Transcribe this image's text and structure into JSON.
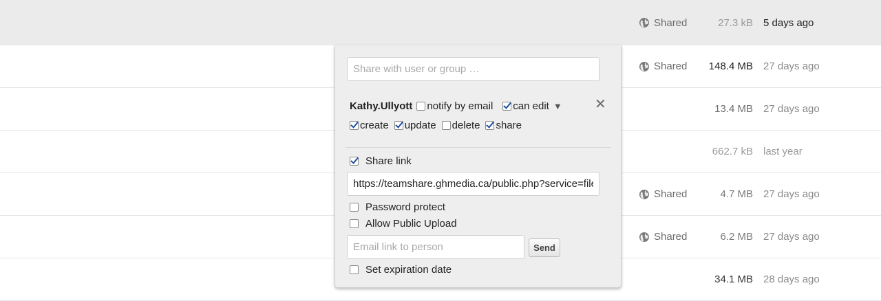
{
  "rows": [
    {
      "shared": "Shared",
      "size": "27.3 kB",
      "date": "5 days ago",
      "size_color": "#9a9a9a",
      "date_color": "#222222"
    },
    {
      "shared": "Shared",
      "size": "148.4 MB",
      "date": "27 days ago",
      "size_color": "#222222",
      "date_color": "#8a8a8a"
    },
    {
      "shared": "",
      "size": "13.4 MB",
      "date": "27 days ago",
      "size_color": "#6e6e6e",
      "date_color": "#8a8a8a"
    },
    {
      "shared": "",
      "size": "662.7 kB",
      "date": "last year",
      "size_color": "#9a9a9a",
      "date_color": "#9a9a9a"
    },
    {
      "shared": "Shared",
      "size": "4.7 MB",
      "date": "27 days ago",
      "size_color": "#7a7a7a",
      "date_color": "#8a8a8a"
    },
    {
      "shared": "Shared",
      "size": "6.2 MB",
      "date": "27 days ago",
      "size_color": "#7a7a7a",
      "date_color": "#8a8a8a"
    },
    {
      "shared": "",
      "size": "34.1 MB",
      "date": "28 days ago",
      "size_color": "#333333",
      "date_color": "#8a8a8a"
    }
  ],
  "share_dialog": {
    "share_with_placeholder": "Share with user or group …",
    "user": {
      "name": "Kathy.Ullyott",
      "notify_label": "notify by email",
      "notify_checked": false,
      "can_edit_label": "can edit",
      "can_edit_checked": true,
      "caret_icon": "triangle-down-icon",
      "close_icon": "close-icon",
      "permissions": [
        {
          "label": "create",
          "checked": true
        },
        {
          "label": "update",
          "checked": true
        },
        {
          "label": "delete",
          "checked": false
        },
        {
          "label": "share",
          "checked": true
        }
      ]
    },
    "share_link_label": "Share link",
    "share_link_checked": true,
    "link_url": "https://teamshare.ghmedia.ca/public.php?service=files&t=",
    "password_label": "Password protect",
    "password_checked": false,
    "public_upload_label": "Allow Public Upload",
    "public_upload_checked": false,
    "email_placeholder": "Email link to person",
    "send_label": "Send",
    "expiration_label": "Set expiration date",
    "expiration_checked": false
  },
  "colors": {
    "highlight_row": "#ebebeb",
    "dialog_bg": "#eeeeee",
    "checkbox_check": "#1a4fa0"
  }
}
